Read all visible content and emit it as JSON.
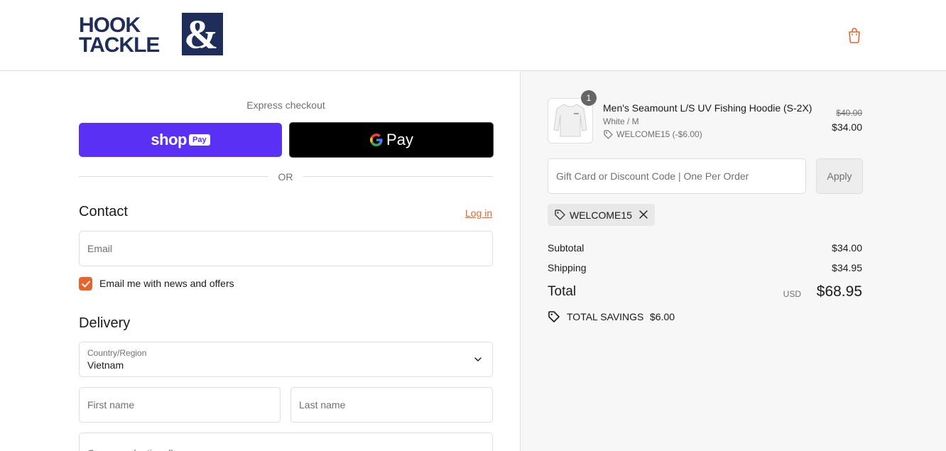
{
  "header": {
    "logo_line1": "HOOK",
    "logo_line2": "TACKLE",
    "logo_amp": "&",
    "cart_icon": "shopping-bag-icon",
    "brand_color": "#1f2d5a",
    "accent_color": "#e8642c"
  },
  "express": {
    "title": "Express checkout",
    "shop_pay_text": "shop",
    "shop_pay_badge": "Pay",
    "gpay_text": "Pay",
    "or_text": "OR"
  },
  "contact": {
    "title": "Contact",
    "login_link": "Log in",
    "email_placeholder": "Email",
    "newsletter_label": "Email me with news and offers",
    "newsletter_checked": true
  },
  "delivery": {
    "title": "Delivery",
    "country_label": "Country/Region",
    "country_value": "Vietnam",
    "first_name_placeholder": "First name",
    "last_name_placeholder": "Last name",
    "company_placeholder": "Company (optional)"
  },
  "cart": {
    "item": {
      "quantity": "1",
      "name": "Men's Seamount L/S UV Fishing Hoodie (S-2X)",
      "variant": "White / M",
      "discount": "WELCOME15 (-$6.00)",
      "price_original": "$40.00",
      "price_final": "$34.00"
    },
    "discount_placeholder": "Gift Card or Discount Code | One Per Order",
    "apply_label": "Apply",
    "applied_code": "WELCOME15",
    "subtotal_label": "Subtotal",
    "subtotal_value": "$34.00",
    "shipping_label": "Shipping",
    "shipping_value": "$34.95",
    "total_label": "Total",
    "total_currency": "USD",
    "total_value": "$68.95",
    "savings_label": "TOTAL SAVINGS",
    "savings_value": "$6.00"
  }
}
